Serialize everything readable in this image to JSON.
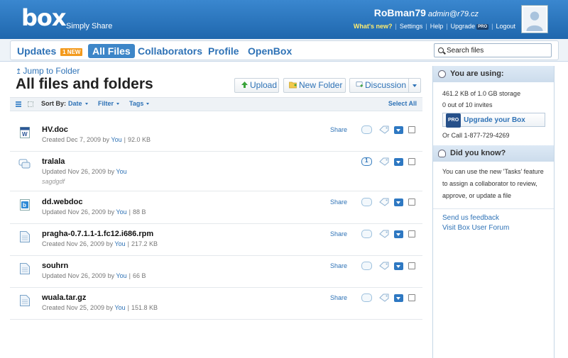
{
  "header": {
    "logo": "box",
    "tagline": "Simply Share",
    "username": "RoBman79",
    "email": "admin@r79.cz",
    "links": {
      "whats_new": "What's new?",
      "settings": "Settings",
      "help": "Help",
      "upgrade": "Upgrade",
      "upgrade_badge": "PRO",
      "logout": "Logout"
    }
  },
  "nav": {
    "updates": "Updates",
    "updates_badge": "1 NEW",
    "all_files": "All Files",
    "collaborators": "Collaborators",
    "profile": "Profile",
    "openbox": "OpenBox",
    "search_placeholder": "Search files"
  },
  "main": {
    "jump_to_folder": "Jump to Folder",
    "title": "All files and folders",
    "toolbar": {
      "upload": "Upload",
      "new_folder": "New Folder",
      "discussion": "Discussion"
    },
    "sort": {
      "label": "Sort By:",
      "date": "Date",
      "filter": "Filter",
      "tags": "Tags",
      "select_all": "Select All"
    },
    "files": [
      {
        "name": "HV.doc",
        "created": "Created Dec 7, 2009 by",
        "by": "You",
        "size": "92.0 KB",
        "share": "Share",
        "icon": "word-doc-icon"
      },
      {
        "name": "tralala",
        "created": "Updated Nov 26, 2009 by",
        "by": "You",
        "description": "sagdgdf",
        "comments": "1",
        "icon": "discussion-icon"
      },
      {
        "name": "dd.webdoc",
        "created": "Updated Nov 26, 2009 by",
        "by": "You",
        "size": "88 B",
        "share": "Share",
        "icon": "webdoc-icon"
      },
      {
        "name": "pragha-0.7.1.1-1.fc12.i686.rpm",
        "created": "Created Nov 26, 2009 by",
        "by": "You",
        "size": "217.2 KB",
        "share": "Share",
        "icon": "file-icon"
      },
      {
        "name": "souhrn",
        "created": "Updated Nov 26, 2009 by",
        "by": "You",
        "size": "66 B",
        "share": "Share",
        "icon": "file-icon"
      },
      {
        "name": "wuala.tar.gz",
        "created": "Created Nov 25, 2009 by",
        "by": "You",
        "size": "151.8 KB",
        "share": "Share",
        "icon": "file-icon"
      }
    ]
  },
  "sidebar": {
    "using_title": "You are using:",
    "storage": "461.2 KB of 1.0 GB storage",
    "invites": "0 out of 10 invites",
    "upgrade_badge": "PRO",
    "upgrade_label": "Upgrade your Box",
    "call": "Or Call 1-877-729-4269",
    "dyk_title": "Did you know?",
    "dyk_text": "You can use the new 'Tasks' feature to assign a collaborator to review, approve, or update a file",
    "feedback": "Send us feedback",
    "forum": "Visit Box User Forum"
  },
  "colors": {
    "header_blue": "#2a77bf",
    "link_blue": "#2e72b6",
    "new_badge": "#f39a1d",
    "whats_new": "#ffec6e"
  }
}
